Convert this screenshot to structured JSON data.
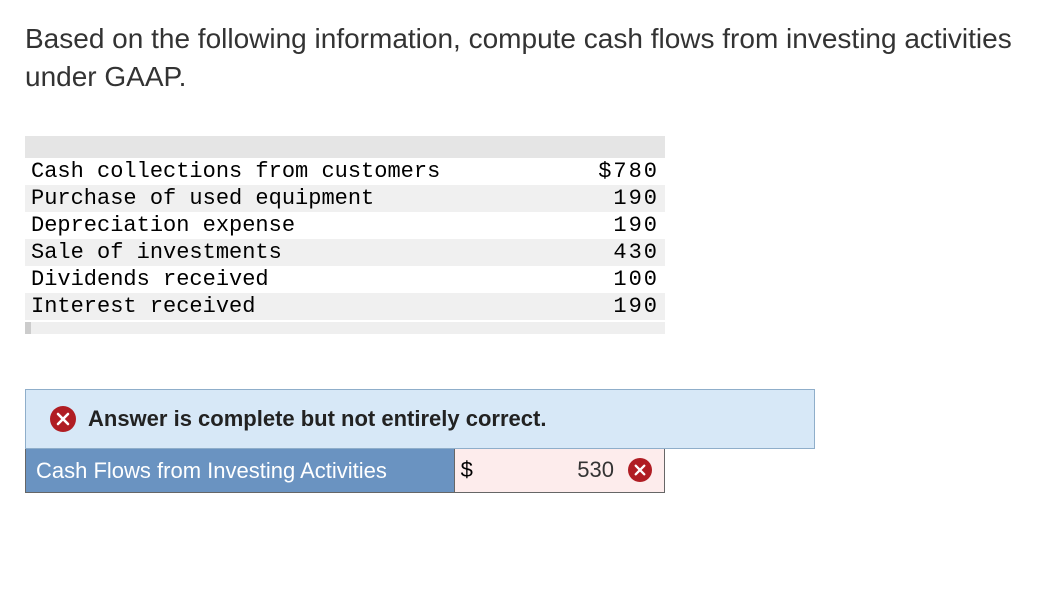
{
  "question": "Based on the following information, compute cash flows from investing activities under GAAP.",
  "data_rows": [
    {
      "label": "Cash collections from customers",
      "value": "$780",
      "shade": false
    },
    {
      "label": "Purchase of used equipment",
      "value": "190",
      "shade": true
    },
    {
      "label": "Depreciation expense",
      "value": "190",
      "shade": false
    },
    {
      "label": "Sale of investments",
      "value": "430",
      "shade": true
    },
    {
      "label": "Dividends received",
      "value": "100",
      "shade": false
    },
    {
      "label": "Interest received",
      "value": "190",
      "shade": true
    }
  ],
  "feedback": {
    "message": "Answer is complete but not entirely correct."
  },
  "answer": {
    "label": "Cash Flows from Investing Activities",
    "currency": "$",
    "value": "530"
  }
}
